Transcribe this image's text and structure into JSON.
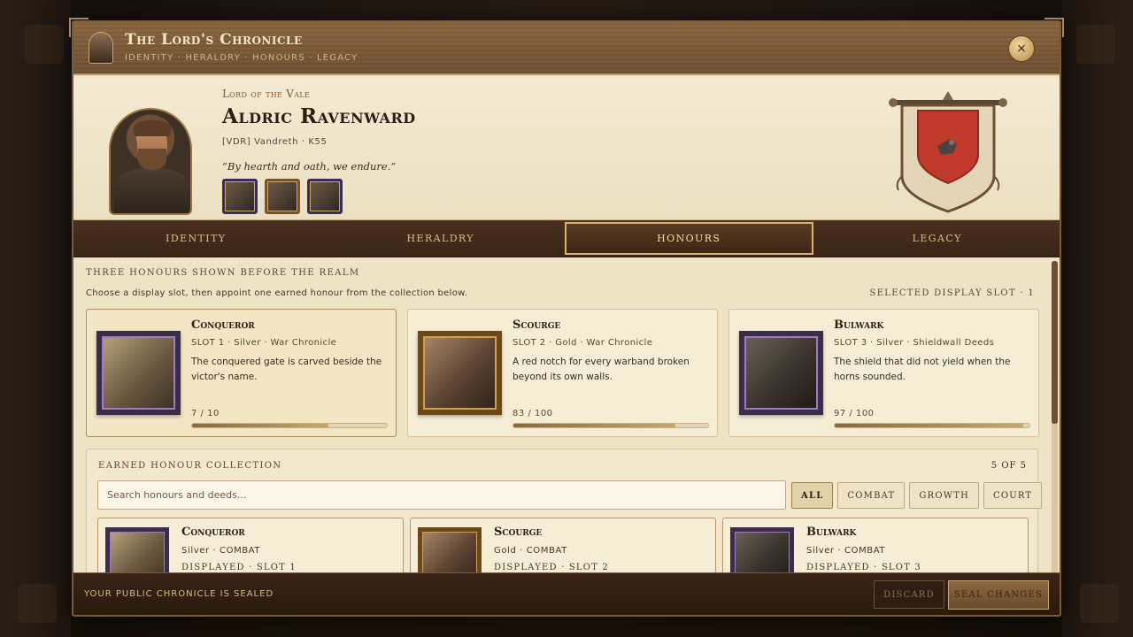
{
  "window": {
    "title": "The Lord's Chronicle",
    "crumbs": "IDENTITY · HERALDRY · HONOURS · LEGACY",
    "close_label": "×"
  },
  "profile": {
    "eyebrow": "Lord of the Vale",
    "name": "Aldric Ravenward",
    "meta": "[VDR] Vandreth · K55",
    "quote": "“By hearth and oath, we endure.”"
  },
  "tabs": [
    {
      "label": "IDENTITY"
    },
    {
      "label": "HERALDRY"
    },
    {
      "label": "HONOURS"
    },
    {
      "label": "LEGACY"
    }
  ],
  "honours": {
    "section_title": "THREE HONOURS SHOWN BEFORE THE REALM",
    "help": "Choose a display slot, then appoint one earned honour from the collection below.",
    "selected_slot": "SELECTED DISPLAY SLOT · 1",
    "slots": [
      {
        "title": "Conqueror",
        "sub": "SLOT 1 · Silver · War Chronicle",
        "desc": "The conquered gate is carved beside the victor's name.",
        "progress": "7 / 10",
        "fill": 0.7
      },
      {
        "title": "Scourge",
        "sub": "SLOT 2 · Gold · War Chronicle",
        "desc": "A red notch for every warband broken beyond its own walls.",
        "progress": "83 / 100",
        "fill": 0.83
      },
      {
        "title": "Bulwark",
        "sub": "SLOT 3 · Silver · Shieldwall Deeds",
        "desc": "The shield that did not yield when the horns sounded.",
        "progress": "97 / 100",
        "fill": 0.97
      }
    ]
  },
  "collection": {
    "title": "EARNED HONOUR COLLECTION",
    "count": "5 OF 5",
    "search_placeholder": "Search honours and deeds...",
    "filters": [
      "ALL",
      "COMBAT",
      "GROWTH",
      "COURT"
    ],
    "cards": [
      {
        "title": "Conqueror",
        "sub": "Silver · COMBAT",
        "status": "DISPLAYED · SLOT 1"
      },
      {
        "title": "Scourge",
        "sub": "Gold · COMBAT",
        "status": "DISPLAYED · SLOT 2"
      },
      {
        "title": "Bulwark",
        "sub": "Silver · COMBAT",
        "status": "DISPLAYED · SLOT 3"
      }
    ]
  },
  "footer": {
    "status": "YOUR PUBLIC CHRONICLE IS SEALED",
    "discard": "DISCARD",
    "seal": "SEAL CHANGES"
  },
  "colors": {
    "crest_field": "#c0392b",
    "accent_gold": "#d8b56a"
  }
}
